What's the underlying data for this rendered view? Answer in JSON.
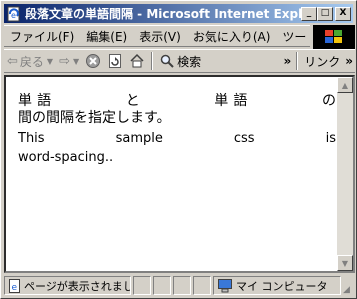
{
  "window": {
    "title": "段落文章の単語間隔 - Microsoft Internet Explorer",
    "minimize": "_",
    "maximize": "□",
    "close": "X"
  },
  "menu": {
    "items": [
      "ファイル(F)",
      "編集(E)",
      "表示(V)",
      "お気に入り(A)",
      "ツー"
    ],
    "more": "»"
  },
  "toolbar": {
    "back": "戻る",
    "search": "検索",
    "links": "リンク",
    "more": "»"
  },
  "page": {
    "para_jp": "単語 と 単語 の 間の間隔を指定します。",
    "para_en": "This sample css is word-spacing.."
  },
  "status": {
    "text": "ページが表示されました",
    "zone": "マイ コンピュータ"
  }
}
